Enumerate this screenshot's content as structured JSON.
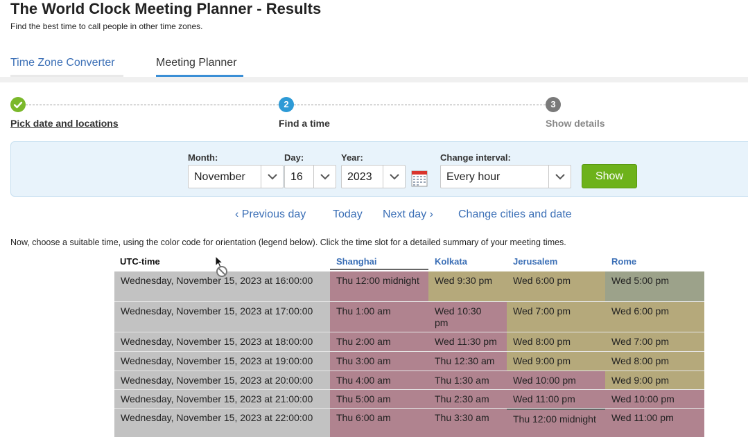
{
  "header": {
    "title": "The World Clock Meeting Planner - Results",
    "subtitle": "Find the best time to call people in other time zones."
  },
  "tabs": [
    {
      "label": "Time Zone Converter"
    },
    {
      "label": "Meeting Planner"
    }
  ],
  "steps": [
    {
      "number": "",
      "label": "Pick date and locations"
    },
    {
      "number": "2",
      "label": "Find a time"
    },
    {
      "number": "3",
      "label": "Show details"
    }
  ],
  "form": {
    "month_label": "Month:",
    "month_value": "November",
    "day_label": "Day:",
    "day_value": "16",
    "year_label": "Year:",
    "year_value": "2023",
    "interval_label": "Change interval:",
    "interval_value": "Every hour",
    "show_label": "Show"
  },
  "nav": {
    "previous": "‹ Previous day",
    "today": "Today",
    "next": "Next day ›",
    "change": "Change cities and date"
  },
  "instructions": "Now, choose a suitable time, using the color code for orientation (legend below). Click the time slot for a detailed summary of your meeting times.",
  "table": {
    "headers": {
      "utc": "UTC-time",
      "shanghai": "Shanghai",
      "kolkata": "Kolkata",
      "jerusalem": "Jerusalem",
      "rome": "Rome"
    },
    "rows": [
      {
        "utc": "Wednesday, November 15, 2023 at 16:00:00",
        "shanghai": "Thu 12:00 midnight",
        "kolkata": "Wed 9:30 pm",
        "jerusalem": "Wed 6:00 pm",
        "rome": "Wed 5:00 pm"
      },
      {
        "utc": "Wednesday, November 15, 2023 at 17:00:00",
        "shanghai": "Thu 1:00 am",
        "kolkata": "Wed 10:30 pm",
        "jerusalem": "Wed 7:00 pm",
        "rome": "Wed 6:00 pm"
      },
      {
        "utc": "Wednesday, November 15, 2023 at 18:00:00",
        "shanghai": "Thu 2:00 am",
        "kolkata": "Wed 11:30 pm",
        "jerusalem": "Wed 8:00 pm",
        "rome": "Wed 7:00 pm"
      },
      {
        "utc": "Wednesday, November 15, 2023 at 19:00:00",
        "shanghai": "Thu 3:00 am",
        "kolkata": "Thu 12:30 am",
        "jerusalem": "Wed 9:00 pm",
        "rome": "Wed 8:00 pm"
      },
      {
        "utc": "Wednesday, November 15, 2023 at 20:00:00",
        "shanghai": "Thu 4:00 am",
        "kolkata": "Thu 1:30 am",
        "jerusalem": "Wed 10:00 pm",
        "rome": "Wed 9:00 pm"
      },
      {
        "utc": "Wednesday, November 15, 2023 at 21:00:00",
        "shanghai": "Thu 5:00 am",
        "kolkata": "Thu 2:30 am",
        "jerusalem": "Wed 11:00 pm",
        "rome": "Wed 10:00 pm"
      },
      {
        "utc": "Wednesday, November 15, 2023 at 22:00:00",
        "shanghai": "Thu 6:00 am",
        "kolkata": "Thu 3:30 am",
        "jerusalem": "Thu 12:00 midnight",
        "rome": "Wed 11:00 pm"
      }
    ]
  },
  "colors": {
    "night": "#b0838f",
    "evening": "#b5a97b",
    "work": "#9ca28a",
    "utc_cell": "#c2c2c2",
    "step_done": "#7ab82a",
    "step_current": "#2d9ad6",
    "step_next": "#7a7a7a",
    "show_button": "#6db21b",
    "link": "#3b6fb6"
  }
}
